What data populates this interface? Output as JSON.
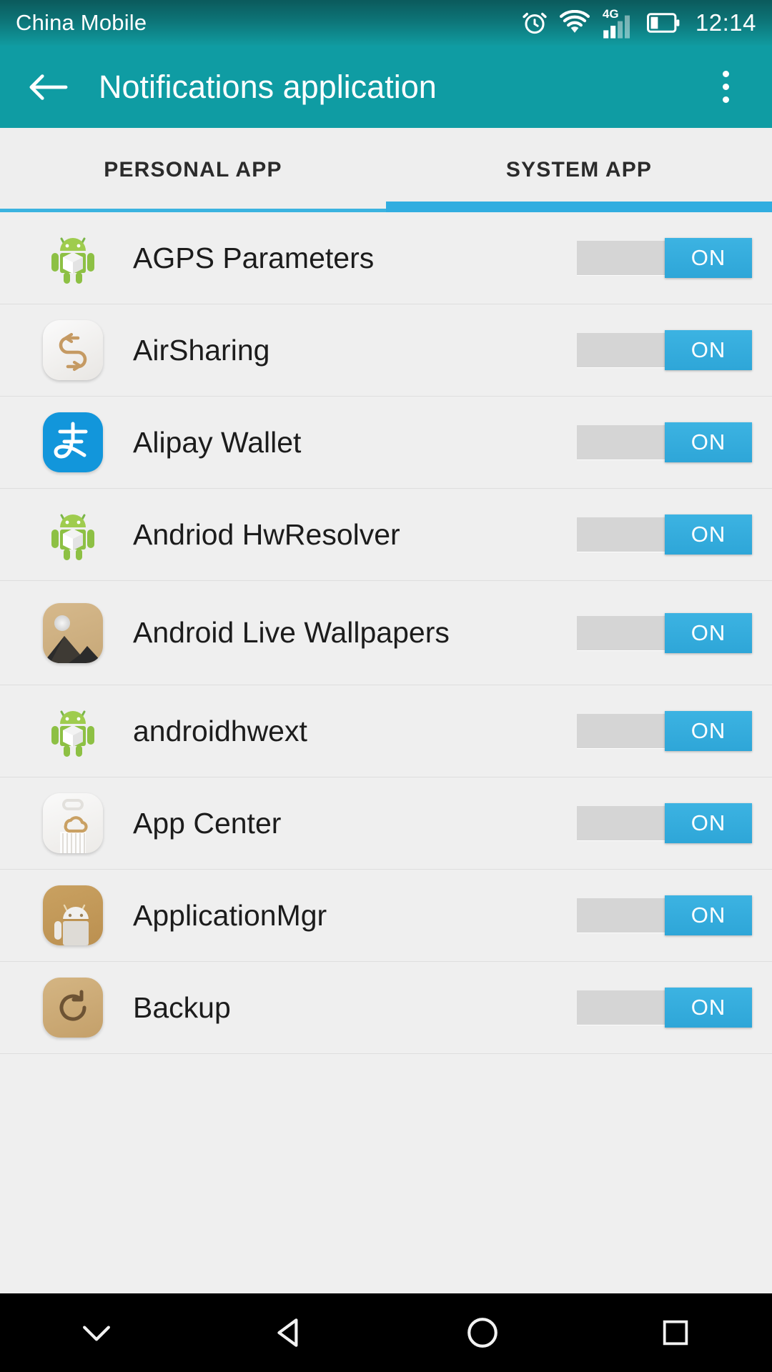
{
  "status_bar": {
    "carrier": "China Mobile",
    "network_type": "4G",
    "time": "12:14",
    "icons": [
      "alarm-icon",
      "wifi-icon",
      "signal-icon",
      "battery-icon"
    ]
  },
  "app_bar": {
    "back_label": "back-arrow",
    "title": "Notifications application",
    "overflow_label": "overflow-menu"
  },
  "tabs": {
    "items": [
      {
        "label": "PERSONAL APP",
        "active": false
      },
      {
        "label": "SYSTEM APP",
        "active": true
      }
    ],
    "active_index": 1,
    "indicator_color": "#31ade0"
  },
  "colors": {
    "appbar": "#0f9ca3",
    "accent": "#31ade0",
    "background": "#efefef",
    "toggle_on": "#33ace0",
    "toggle_track": "#d5d5d5",
    "divider": "#dedede"
  },
  "list": {
    "rows": [
      {
        "name": "AGPS Parameters",
        "icon": "android-robot-icon",
        "toggle": "ON",
        "toggle_state": true
      },
      {
        "name": "AirSharing",
        "icon": "airsharing-icon",
        "toggle": "ON",
        "toggle_state": true
      },
      {
        "name": "Alipay Wallet",
        "icon": "alipay-icon",
        "toggle": "ON",
        "toggle_state": true
      },
      {
        "name": "Andriod HwResolver",
        "icon": "android-robot-icon",
        "toggle": "ON",
        "toggle_state": true
      },
      {
        "name": "Android Live Wallpapers",
        "icon": "live-wallpapers-icon",
        "toggle": "ON",
        "toggle_state": true
      },
      {
        "name": "androidhwext",
        "icon": "android-robot-icon",
        "toggle": "ON",
        "toggle_state": true
      },
      {
        "name": "App Center",
        "icon": "app-center-icon",
        "toggle": "ON",
        "toggle_state": true
      },
      {
        "name": "ApplicationMgr",
        "icon": "application-mgr-icon",
        "toggle": "ON",
        "toggle_state": true
      },
      {
        "name": "Backup",
        "icon": "backup-icon",
        "toggle": "ON",
        "toggle_state": true
      }
    ]
  },
  "nav_bar": {
    "buttons": [
      "hide-keyboard-icon",
      "back-triangle-icon",
      "home-circle-icon",
      "recents-square-icon"
    ]
  }
}
